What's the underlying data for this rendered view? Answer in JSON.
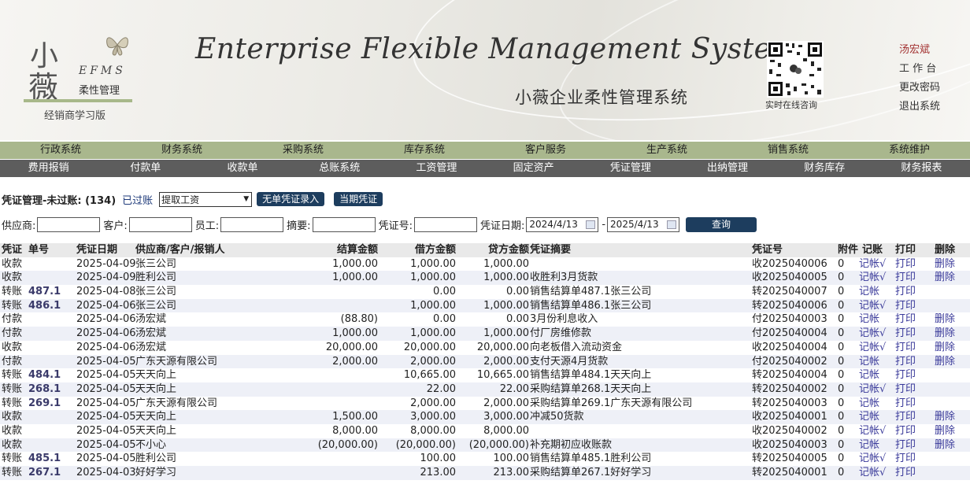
{
  "header": {
    "logo_char1": "小",
    "logo_char2": "薇",
    "logo_efms": "EFMS",
    "logo_sub": "柔性管理",
    "logo_edition": "经销商学习版",
    "title_en": "Enterprise Flexible Management System",
    "title_cn": "小薇企业柔性管理系统",
    "qr_label": "实时在线咨询",
    "user_name": "汤宏斌",
    "links": [
      "工 作 台",
      "更改密码",
      "退出系统"
    ]
  },
  "nav_primary": [
    "行政系统",
    "财务系统",
    "采购系统",
    "库存系统",
    "客户服务",
    "生产系统",
    "销售系统",
    "系统维护"
  ],
  "nav_secondary": [
    "费用报销",
    "付款单",
    "收款单",
    "总账系统",
    "工资管理",
    "固定资产",
    "凭证管理",
    "出纳管理",
    "财务库存",
    "财务报表"
  ],
  "toolbar": {
    "page_title": "凭证管理-未过账: (134)",
    "posted_link": "已过账",
    "select_value": "提取工资",
    "btn_no_doc": "无单凭证录入",
    "btn_current": "当期凭证"
  },
  "filters": {
    "supplier_label": "供应商:",
    "customer_label": "客户:",
    "employee_label": "员工:",
    "summary_label": "摘要:",
    "voucher_no_label": "凭证号:",
    "date_label": "凭证日期:",
    "date_from": "2024/4/13",
    "date_to": "2025/4/13",
    "date_sep": "-",
    "query_button": "查询"
  },
  "table": {
    "headers": {
      "type": "凭证",
      "no": "单号",
      "date": "凭证日期",
      "party": "供应商/客户/报销人",
      "settle": "结算金额",
      "debit": "借方金额",
      "credit": "贷方金额",
      "summary": "凭证摘要",
      "vno": "凭证号",
      "att": "附件",
      "post": "记账",
      "print": "打印",
      "del": "删除"
    },
    "rows": [
      {
        "type": "收款",
        "no": "",
        "date": "2025-04-09",
        "party": "张三公司",
        "settle": "1,000.00",
        "debit": "1,000.00",
        "credit": "1,000.00",
        "summary": "",
        "vno": "收2025040006",
        "att": "0",
        "post": "记帐√",
        "print": "打印",
        "del": "删除"
      },
      {
        "type": "收款",
        "no": "",
        "date": "2025-04-09",
        "party": "胜利公司",
        "settle": "1,000.00",
        "debit": "1,000.00",
        "credit": "1,000.00",
        "summary": "收胜利3月货款",
        "vno": "收2025040005",
        "att": "0",
        "post": "记帐√",
        "print": "打印",
        "del": "删除"
      },
      {
        "type": "转账",
        "no": "487.1",
        "date": "2025-04-08",
        "party": "张三公司",
        "settle": "",
        "debit": "0.00",
        "credit": "0.00",
        "summary": "销售结算单487.1张三公司",
        "vno": "转2025040007",
        "att": "0",
        "post": "记帐",
        "print": "打印",
        "del": ""
      },
      {
        "type": "转账",
        "no": "486.1",
        "date": "2025-04-06",
        "party": "张三公司",
        "settle": "",
        "debit": "1,000.00",
        "credit": "1,000.00",
        "summary": "销售结算单486.1张三公司",
        "vno": "转2025040006",
        "att": "0",
        "post": "记帐√",
        "print": "打印",
        "del": ""
      },
      {
        "type": "付款",
        "no": "",
        "date": "2025-04-06",
        "party": "汤宏斌",
        "settle": "(88.80)",
        "debit": "0.00",
        "credit": "0.00",
        "summary": "3月份利息收入",
        "vno": "付2025040003",
        "att": "0",
        "post": "记帐",
        "print": "打印",
        "del": "删除"
      },
      {
        "type": "付款",
        "no": "",
        "date": "2025-04-06",
        "party": "汤宏斌",
        "settle": "1,000.00",
        "debit": "1,000.00",
        "credit": "1,000.00",
        "summary": "付厂房维修款",
        "vno": "付2025040004",
        "att": "0",
        "post": "记帐√",
        "print": "打印",
        "del": "删除"
      },
      {
        "type": "收款",
        "no": "",
        "date": "2025-04-06",
        "party": "汤宏斌",
        "settle": "20,000.00",
        "debit": "20,000.00",
        "credit": "20,000.00",
        "summary": "向老板借入流动资金",
        "vno": "收2025040004",
        "att": "0",
        "post": "记帐√",
        "print": "打印",
        "del": "删除"
      },
      {
        "type": "付款",
        "no": "",
        "date": "2025-04-05",
        "party": "广东天源有限公司",
        "settle": "2,000.00",
        "debit": "2,000.00",
        "credit": "2,000.00",
        "summary": "支付天源4月货款",
        "vno": "付2025040002",
        "att": "0",
        "post": "记帐",
        "print": "打印",
        "del": "删除"
      },
      {
        "type": "转账",
        "no": "484.1",
        "date": "2025-04-05",
        "party": "天天向上",
        "settle": "",
        "debit": "10,665.00",
        "credit": "10,665.00",
        "summary": "销售结算单484.1天天向上",
        "vno": "转2025040004",
        "att": "0",
        "post": "记帐",
        "print": "打印",
        "del": ""
      },
      {
        "type": "转账",
        "no": "268.1",
        "date": "2025-04-05",
        "party": "天天向上",
        "settle": "",
        "debit": "22.00",
        "credit": "22.00",
        "summary": "采购结算单268.1天天向上",
        "vno": "转2025040002",
        "att": "0",
        "post": "记帐√",
        "print": "打印",
        "del": ""
      },
      {
        "type": "转账",
        "no": "269.1",
        "date": "2025-04-05",
        "party": "广东天源有限公司",
        "settle": "",
        "debit": "2,000.00",
        "credit": "2,000.00",
        "summary": "采购结算单269.1广东天源有限公司",
        "vno": "转2025040003",
        "att": "0",
        "post": "记帐",
        "print": "打印",
        "del": ""
      },
      {
        "type": "收款",
        "no": "",
        "date": "2025-04-05",
        "party": "天天向上",
        "settle": "1,500.00",
        "debit": "3,000.00",
        "credit": "3,000.00",
        "summary": "冲减50货款",
        "vno": "收2025040001",
        "att": "0",
        "post": "记帐",
        "print": "打印",
        "del": "删除"
      },
      {
        "type": "收款",
        "no": "",
        "date": "2025-04-05",
        "party": "天天向上",
        "settle": "8,000.00",
        "debit": "8,000.00",
        "credit": "8,000.00",
        "summary": "",
        "vno": "收2025040002",
        "att": "0",
        "post": "记帐√",
        "print": "打印",
        "del": "删除"
      },
      {
        "type": "收款",
        "no": "",
        "date": "2025-04-05",
        "party": "不小心",
        "settle": "(20,000.00)",
        "debit": "(20,000.00)",
        "credit": "(20,000.00)",
        "summary": "补充期初应收账款",
        "vno": "收2025040003",
        "att": "0",
        "post": "记帐",
        "print": "打印",
        "del": "删除"
      },
      {
        "type": "转账",
        "no": "485.1",
        "date": "2025-04-05",
        "party": "胜利公司",
        "settle": "",
        "debit": "100.00",
        "credit": "100.00",
        "summary": "销售结算单485.1胜利公司",
        "vno": "转2025040005",
        "att": "0",
        "post": "记帐√",
        "print": "打印",
        "del": ""
      },
      {
        "type": "转账",
        "no": "267.1",
        "date": "2025-04-03",
        "party": "好好学习",
        "settle": "",
        "debit": "213.00",
        "credit": "213.00",
        "summary": "采购结算单267.1好好学习",
        "vno": "转2025040001",
        "att": "0",
        "post": "记帐√",
        "print": "打印",
        "del": ""
      }
    ]
  }
}
